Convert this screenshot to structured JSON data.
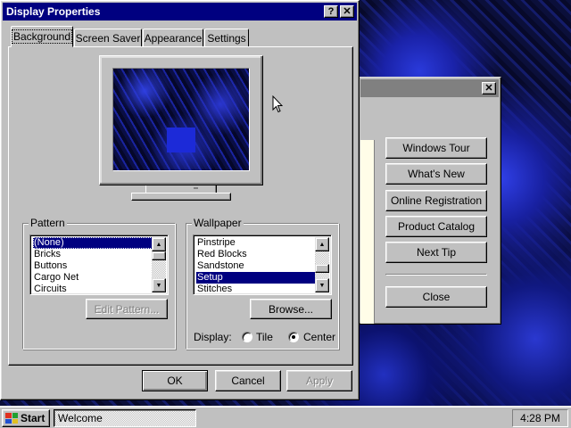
{
  "dialog": {
    "title": "Display Properties",
    "help_button": "?",
    "close_button": "✕",
    "tabs": [
      {
        "label": "Background",
        "active": true
      },
      {
        "label": "Screen Saver",
        "active": false
      },
      {
        "label": "Appearance",
        "active": false
      },
      {
        "label": "Settings",
        "active": false
      }
    ],
    "pattern": {
      "group_label": "Pattern",
      "items": [
        "(None)",
        "Bricks",
        "Buttons",
        "Cargo Net",
        "Circuits"
      ],
      "selected": "(None)",
      "edit_button": "Edit Pattern..."
    },
    "wallpaper": {
      "group_label": "Wallpaper",
      "items": [
        "Pinstripe",
        "Red Blocks",
        "Sandstone",
        "Setup",
        "Stitches"
      ],
      "selected": "Setup",
      "browse_button": "Browse...",
      "display_label": "Display:",
      "options": [
        {
          "label": "Tile",
          "checked": false
        },
        {
          "label": "Center",
          "checked": true
        }
      ]
    },
    "buttons": {
      "ok": "OK",
      "cancel": "Cancel",
      "apply": "Apply"
    }
  },
  "welcome_window": {
    "close_button": "✕",
    "buttons": [
      "Windows Tour",
      "What's New",
      "Online Registration",
      "Product Catalog",
      "Next Tip",
      "Close"
    ]
  },
  "taskbar": {
    "start_label": "Start",
    "items": [
      "Welcome"
    ],
    "clock": "4:28 PM"
  },
  "colors": {
    "title_active": "#000080",
    "title_inactive": "#808080",
    "face": "#c0c0c0",
    "selection": "#000080",
    "desktop": "#0b0f40"
  }
}
